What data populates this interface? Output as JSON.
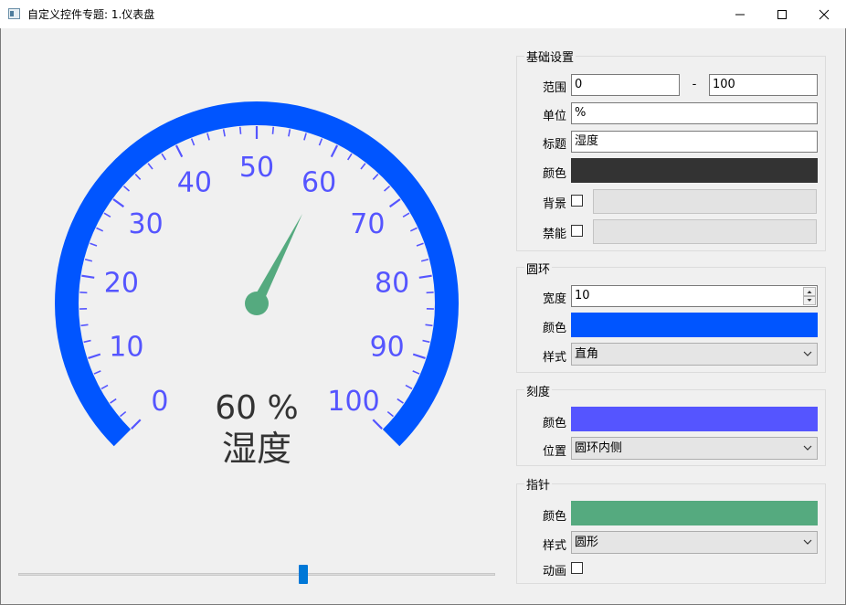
{
  "window": {
    "title": "自定义控件专题: 1.仪表盘"
  },
  "gauge": {
    "min": 0,
    "max": 100,
    "value": 60,
    "unit": "%",
    "title": "湿度",
    "value_text": "60 %",
    "tick_labels": [
      "0",
      "10",
      "20",
      "30",
      "40",
      "50",
      "60",
      "70",
      "80",
      "90",
      "100"
    ],
    "ring_color": "#0055ff",
    "scale_color": "#5555ff",
    "pointer_color": "#55aa7f",
    "text_color": "#333333",
    "ring_style": "直角",
    "scale_position": "圆环内侧",
    "pointer_style": "圆形"
  },
  "slider": {
    "value": 60,
    "min": 0,
    "max": 100
  },
  "basic": {
    "group_title": "基础设置",
    "range_label": "范围",
    "range_min": "0",
    "range_sep": "-",
    "range_max": "100",
    "unit_label": "单位",
    "unit_value": "%",
    "title_label": "标题",
    "title_value": "湿度",
    "color_label": "颜色",
    "color": "#333333",
    "background_label": "背景",
    "disabled_label": "禁能"
  },
  "ring": {
    "group_title": "圆环",
    "width_label": "宽度",
    "width_value": "10",
    "color_label": "颜色",
    "color": "#0055ff",
    "style_label": "样式",
    "style_value": "直角"
  },
  "scale": {
    "group_title": "刻度",
    "color_label": "颜色",
    "color": "#5555ff",
    "position_label": "位置",
    "position_value": "圆环内侧"
  },
  "pointer": {
    "group_title": "指针",
    "color_label": "颜色",
    "color": "#55aa7f",
    "style_label": "样式",
    "style_value": "圆形",
    "animation_label": "动画"
  }
}
